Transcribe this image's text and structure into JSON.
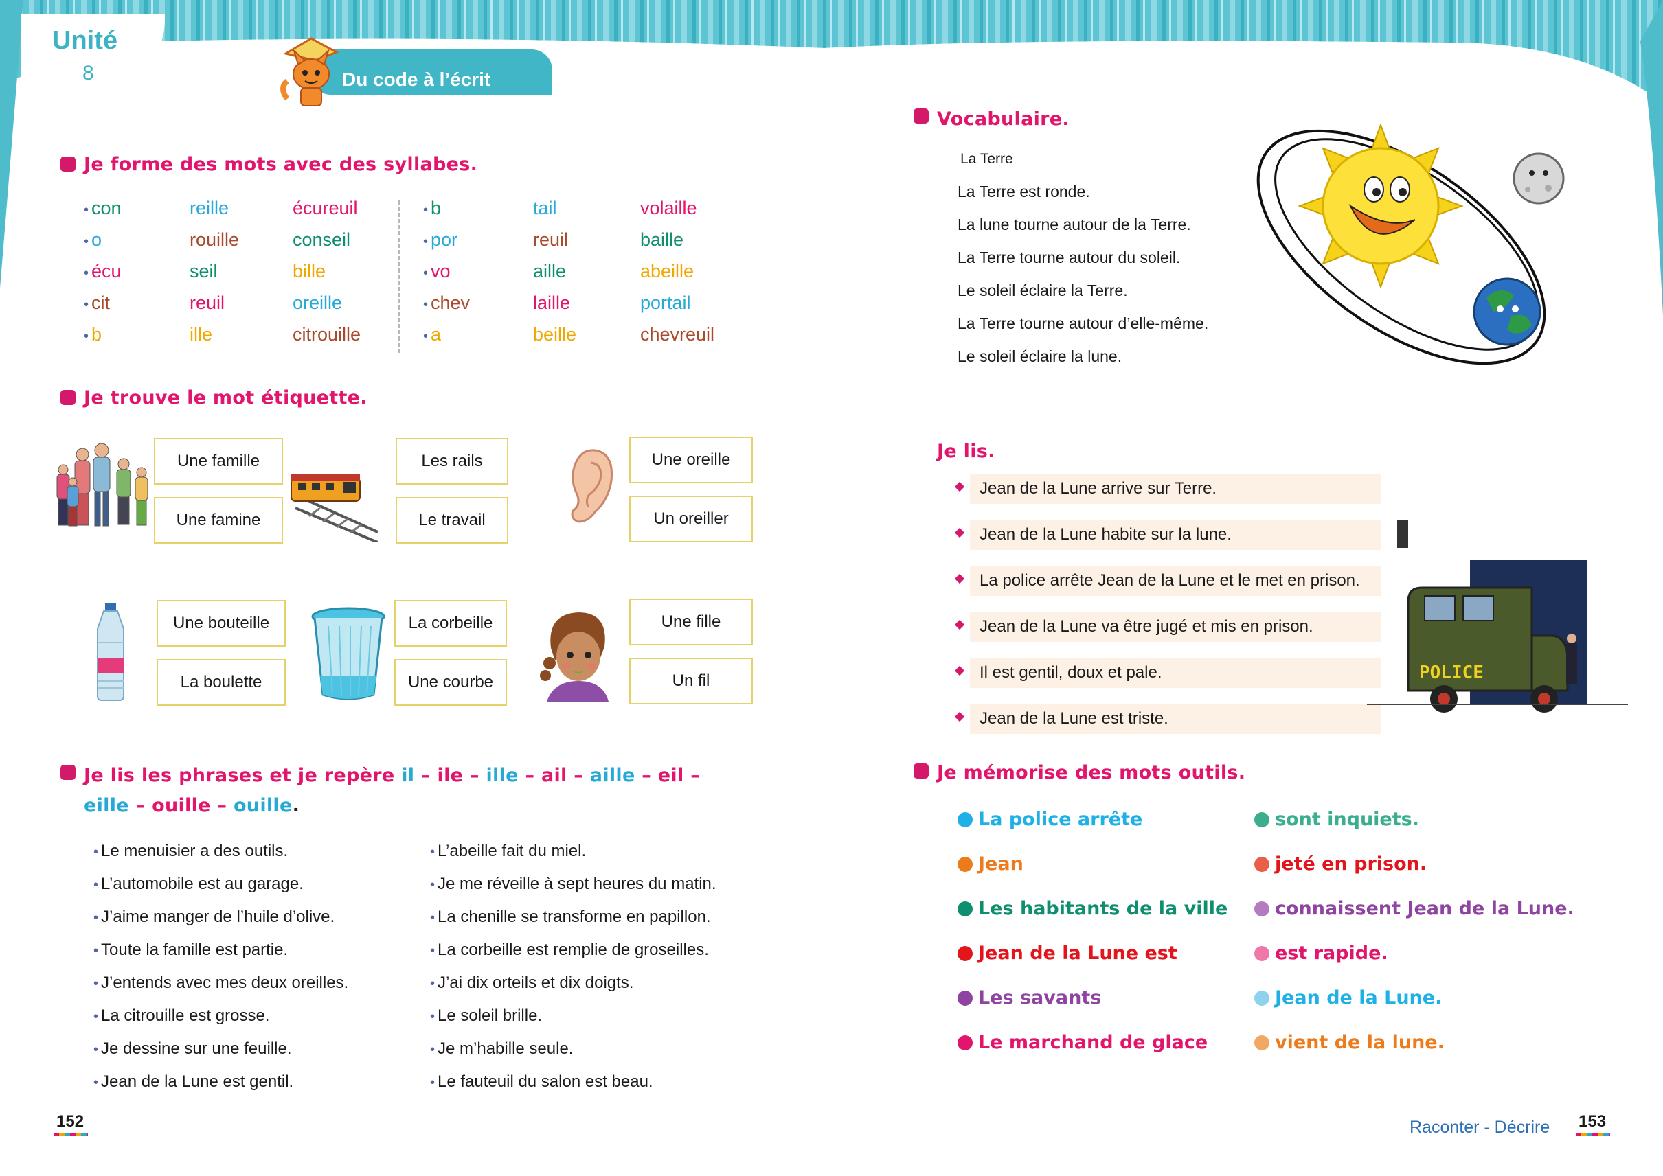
{
  "header": {
    "unit_word": "Unité",
    "unit_number": "8",
    "banner": "Du code à l’écrit"
  },
  "syllables": {
    "title": "Je forme des mots avec des syllabes.",
    "columns": [
      {
        "items": [
          "con",
          "o",
          "écu",
          "cit",
          "b"
        ],
        "colors": [
          "#0f8f6f",
          "#27a9d6",
          "#e2156c",
          "#a84a2b",
          "#f0a800"
        ],
        "bullet": true
      },
      {
        "items": [
          "reille",
          "rouille",
          "seil",
          "reuil",
          "ille"
        ],
        "colors": [
          "#27a9d6",
          "#a84a2b",
          "#0f8f6f",
          "#e2156c",
          "#f0a800"
        ],
        "bullet": false
      },
      {
        "items": [
          "écureuil",
          "conseil",
          "bille",
          "oreille",
          "citrouille"
        ],
        "colors": [
          "#e2156c",
          "#0f8f6f",
          "#f0a800",
          "#27a9d6",
          "#a84a2b"
        ],
        "bullet": false
      },
      {
        "items": [
          "b",
          "por",
          "vo",
          "chev",
          "a"
        ],
        "colors": [
          "#0f8f6f",
          "#27a9d6",
          "#e2156c",
          "#a84a2b",
          "#f0a800"
        ],
        "bullet": true
      },
      {
        "items": [
          "tail",
          "reuil",
          "aille",
          "laille",
          "beille"
        ],
        "colors": [
          "#27a9d6",
          "#a84a2b",
          "#0f8f6f",
          "#e2156c",
          "#f0a800"
        ],
        "bullet": false
      },
      {
        "items": [
          "volaille",
          "baille",
          "abeille",
          "portail",
          "chevreuil"
        ],
        "colors": [
          "#e2156c",
          "#0f8f6f",
          "#f0a800",
          "#27a9d6",
          "#a84a2b"
        ],
        "bullet": false
      }
    ]
  },
  "labels": {
    "title": "Je trouve le mot étiquette.",
    "words": [
      "Une famille",
      "Une famine",
      "Les rails",
      "Le travail",
      "Une oreille",
      "Un oreiller",
      "Une bouteille",
      "La boulette",
      "La corbeille",
      "Une courbe",
      "Une fille",
      "Un fil"
    ]
  },
  "phrases": {
    "title_prefix": "Je lis les phrases et je repère",
    "markers": [
      {
        "t": "il",
        "c": "#27a9d6"
      },
      {
        "t": "ile",
        "c": "#e2156c"
      },
      {
        "t": "ille",
        "c": "#27a9d6"
      },
      {
        "t": "ail",
        "c": "#e2156c"
      },
      {
        "t": "aille",
        "c": "#27a9d6"
      },
      {
        "t": "eil",
        "c": "#e2156c"
      },
      {
        "t": "eille",
        "c": "#27a9d6"
      },
      {
        "t": "ouille",
        "c": "#e2156c"
      },
      {
        "t": "ouille",
        "c": "#27a9d6"
      }
    ],
    "left": [
      "Le menuisier a des outils.",
      "L’automobile est au garage.",
      "J’aime manger de l’huile d’olive.",
      "Toute la famille est partie.",
      "J’entends avec mes deux oreilles.",
      "La citrouille est grosse.",
      "Je dessine sur une feuille.",
      "Jean de la Lune est gentil."
    ],
    "right": [
      "L’abeille fait du miel.",
      "Je me réveille à sept heures du matin.",
      "La chenille se transforme en papillon.",
      "La corbeille est remplie de groseilles.",
      "J’ai dix orteils et dix doigts.",
      "Le soleil brille.",
      "Je m’habille seule.",
      "Le fauteuil du salon est beau."
    ]
  },
  "vocab": {
    "title": "Vocabulaire.",
    "subtitle": "La Terre",
    "lines": [
      "La Terre est ronde.",
      "La lune tourne autour de la Terre.",
      "La Terre tourne autour du soleil.",
      "Le soleil éclaire la Terre.",
      "La Terre tourne autour d’elle-même.",
      "Le soleil éclaire la lune."
    ]
  },
  "jelis": {
    "title": "Je lis.",
    "lines": [
      "Jean de la Lune arrive sur Terre.",
      "Jean de la Lune habite sur la lune.",
      "La police arrête Jean de la Lune et le met en prison.",
      "Jean de la Lune va être jugé et mis en prison.",
      "Il est gentil, doux et pale.",
      "Jean de la Lune est triste."
    ],
    "truck_label": "POLICE"
  },
  "memo": {
    "title": "Je mémorise des mots outils.",
    "left": [
      {
        "t": "La police arrête",
        "c": "#1fb1e6"
      },
      {
        "t": "Jean",
        "c": "#ee7b1b"
      },
      {
        "t": "Les habitants de la ville",
        "c": "#0f8f6f"
      },
      {
        "t": "Jean de la Lune est",
        "c": "#e3151c"
      },
      {
        "t": "Les savants",
        "c": "#8e44a0"
      },
      {
        "t": "Le marchand de glace",
        "c": "#e2156c"
      }
    ],
    "right": [
      {
        "t": "sont inquiets.",
        "c": "#3aae8f"
      },
      {
        "t": "jeté en prison.",
        "c": "#e3151c",
        "dot": "#e8604a"
      },
      {
        "t": "connaissent Jean de la Lune.",
        "c": "#8e44a0",
        "dot": "#b57bc1"
      },
      {
        "t": "est rapide.",
        "c": "#e2156c",
        "dot": "#ef78a8"
      },
      {
        "t": "Jean de la Lune.",
        "c": "#1fb1e6",
        "dot": "#8ed2ee"
      },
      {
        "t": "vient de la lune.",
        "c": "#ee7b1b",
        "dot": "#f0a864"
      }
    ]
  },
  "footer": {
    "left_page": "152",
    "right_text": "Raconter - Décrire",
    "right_page": "153"
  }
}
